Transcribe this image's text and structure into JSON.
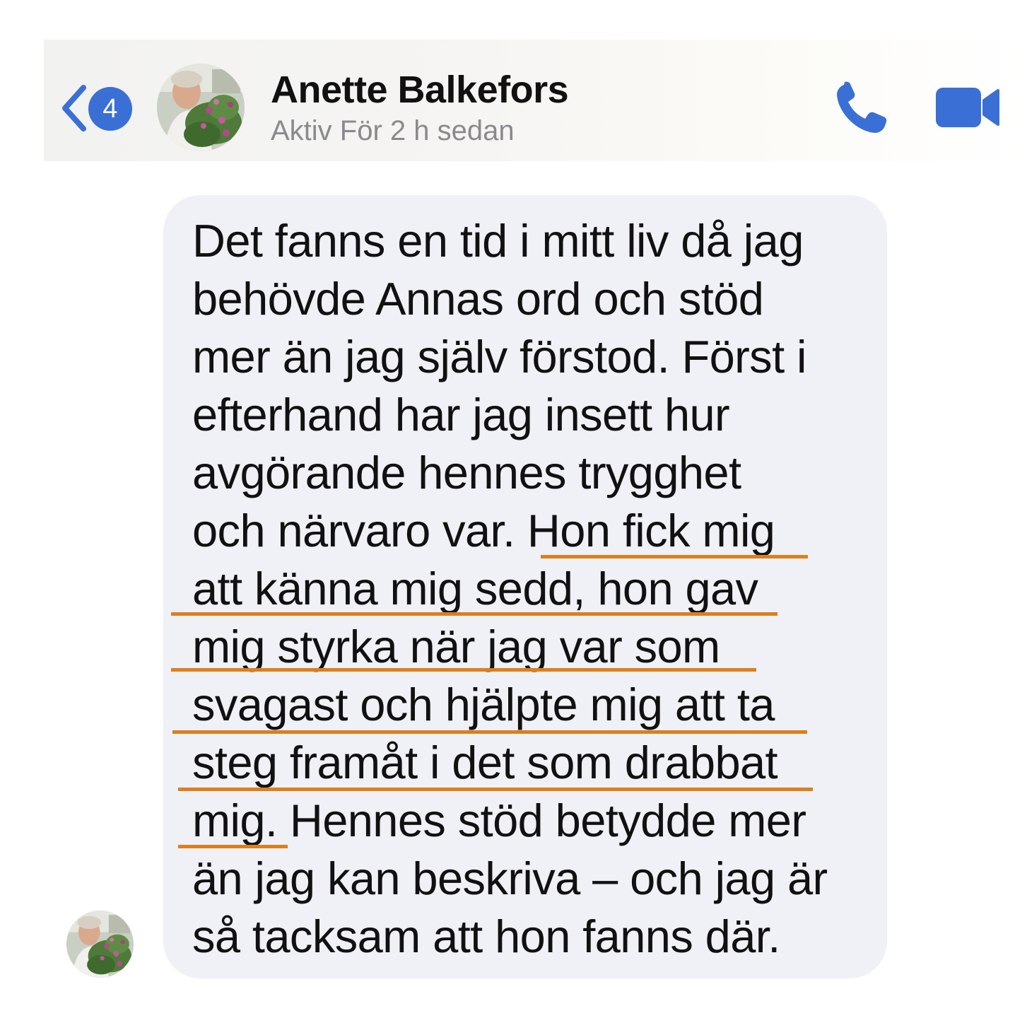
{
  "header": {
    "unread_count": "4",
    "contact_name": "Anette Balkefors",
    "status": "Aktiv För 2 h sedan",
    "icons": {
      "back": "chevron-left-icon",
      "call": "phone-icon",
      "video": "video-camera-icon"
    }
  },
  "message": {
    "lines": [
      "Det fanns en tid i mitt liv då jag",
      "behövde Annas ord och stöd",
      "mer än jag själv förstod. Först i",
      "efterhand har jag insett hur",
      "avgörande hennes trygghet",
      "och närvaro var. Hon fick mig",
      "att känna mig sedd, hon gav",
      "mig styrka när jag var som",
      "svagast och hjälpte mig att ta",
      "steg framåt i det som drabbat",
      "mig. Hennes stöd betydde mer",
      "än jag kan beskriva – och jag är",
      "så tacksam att hon fanns där."
    ],
    "highlighted_text": "Hon fick mig att känna mig sedd, hon gav mig styrka när jag var som svagast och hjälpte mig att ta steg framåt i det som drabbat mig."
  },
  "colors": {
    "accent": "#3a6fd6",
    "bubble": "#f0f1f6",
    "underline": "#dd7f1c",
    "status_text": "#8a8a8e"
  }
}
